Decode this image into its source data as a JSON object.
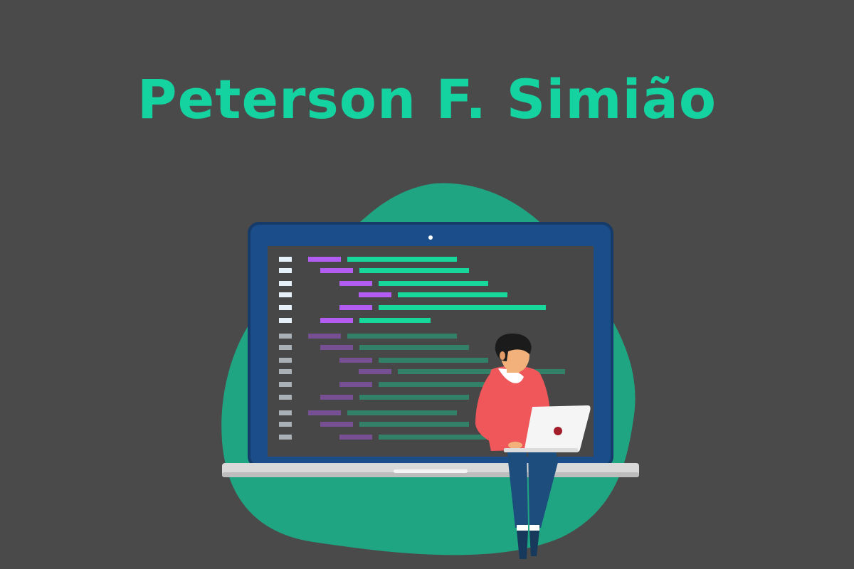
{
  "header": {
    "title": "Peterson F. Simião"
  },
  "colors": {
    "background": "#4a4a4a",
    "title": "#14d3a0",
    "blob": "#20a583",
    "laptop_frame": "#1b4d8a",
    "screen": "#474747",
    "code_keyword": "#b25cf1",
    "code_value": "#17d79a",
    "line_number": "#e6f0f8",
    "sweater": "#f0575a",
    "jeans": "#1c4d7d"
  },
  "illustration": {
    "blob": "blob-shape",
    "device": "laptop-icon",
    "person": "developer-figure",
    "small_device": "small-laptop-icon"
  }
}
